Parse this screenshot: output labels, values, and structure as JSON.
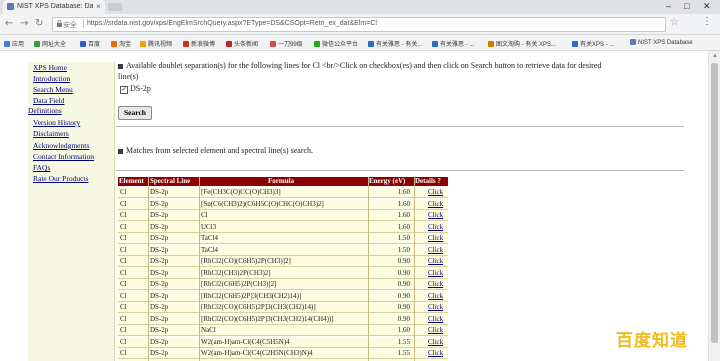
{
  "browser": {
    "tab_title": "NIST XPS Database: Da",
    "tab_close": "×",
    "win_min": "–",
    "win_max": "□",
    "win_close": "✕",
    "security_label": "安全",
    "url": "https://srdata.nist.gov/xps/EngElmSrchQuery.aspx?EType=DS&CSOpt=Retri_ex_dat&Elm=Cl",
    "back": "←",
    "forward": "→",
    "reload": "↻",
    "star": "☆",
    "menu": "⋮"
  },
  "bookmarks": [
    {
      "label": "应用",
      "color": "#4a7ad1"
    },
    {
      "label": "网址大全",
      "color": "#3b9c3b"
    },
    {
      "label": "百度",
      "color": "#2a5bd7"
    },
    {
      "label": "淘宝",
      "color": "#ff6600"
    },
    {
      "label": "腾讯视频",
      "color": "#ff9900"
    },
    {
      "label": "新浪微博",
      "color": "#d52b1e"
    },
    {
      "label": "头条新闻",
      "color": "#cc2222"
    },
    {
      "label": "一刀99级",
      "color": "#d44"
    },
    {
      "label": "微信公众平台",
      "color": "#1aad19"
    },
    {
      "label": "有关雅思 - 有关...",
      "color": "#2c6cc4"
    },
    {
      "label": "有关雅思 - ...",
      "color": "#2c6cc4"
    },
    {
      "label": "图文淘购 - 有关 XPS...",
      "color": "#d97b00"
    },
    {
      "label": "有关XPS - ...",
      "color": "#2c6cc4"
    },
    {
      "label": "NIST XPS Database",
      "color": "#5b7fb0"
    }
  ],
  "sidebar": {
    "items": [
      "XPS Home",
      "Introduction",
      "Search Menu",
      "Data Field",
      "Definitions",
      "Version History",
      "Disclaimers",
      "Acknowledgments",
      "Contact Information",
      "FAQs",
      "Rate Our Products"
    ]
  },
  "form": {
    "instruction": "Available doublet separation(s) for the following lines for Cl <br/>Click on checkbox(es) and then click on Search button to retrieve data for desired",
    "instruction_line2": "line(s)",
    "checkbox_label": "DS-2p",
    "checkbox_checked": "✓",
    "search_button": "Search"
  },
  "results": {
    "heading": "Matches from selected element and spectral line(s) search.",
    "columns": [
      "Element",
      "Spectral Line",
      "Formula",
      "Energy (eV)",
      "Details ?"
    ],
    "rows": [
      [
        "Cl",
        "DS-2p",
        "[Fe(CH3C(O)CC(O)CH3)3]",
        "1.60",
        "Click"
      ],
      [
        "Cl",
        "DS-2p",
        "[Sn(C6(CH3)2)(C6H5C(O)CHC(O)CH3)2]",
        "1.60",
        "Click"
      ],
      [
        "Cl",
        "DS-2p",
        "Cl",
        "1.60",
        "Click"
      ],
      [
        "Cl",
        "DS-2p",
        "UCl3",
        "1.60",
        "Click"
      ],
      [
        "Cl",
        "DS-2p",
        "TaCl4",
        "1.50",
        "Click"
      ],
      [
        "Cl",
        "DS-2p",
        "TaCl4",
        "1.50",
        "Click"
      ],
      [
        "Cl",
        "DS-2p",
        "[RhCl2(CO)(C6H5)2P(CH3)]2]",
        "0.90",
        "Click"
      ],
      [
        "Cl",
        "DS-2p",
        "[RhCl2(CH3)2P(CH3)2]",
        "0.90",
        "Click"
      ],
      [
        "Cl",
        "DS-2p",
        "[RhCl2(C6H5)2P(CH3)]2]",
        "0.90",
        "Click"
      ],
      [
        "Cl",
        "DS-2p",
        "[RhCl2(C6H5)2P]3(CH3(CH2)14)]",
        "0.90",
        "Click"
      ],
      [
        "Cl",
        "DS-2p",
        "[RhCl2(CO)(C6H5)2P]3(CH3(CH2)14)]",
        "0.90",
        "Click"
      ],
      [
        "Cl",
        "DS-2p",
        "[RhCl2(CO)(C6H5)2P]3(CH3(CH2)14(CH4))]",
        "0.90",
        "Click"
      ],
      [
        "Cl",
        "DS-2p",
        "NaCl",
        "1.60",
        "Click"
      ],
      [
        "Cl",
        "DS-2p",
        "W2(am-H)am-Cl(C4(C5H5N)4",
        "1.55",
        "Click"
      ],
      [
        "Cl",
        "DS-2p",
        "W2(am-H)am-Cl(C4(C2H5N(CH3)N)4",
        "1.55",
        "Click"
      ],
      [
        "Cl",
        "DS-2p",
        "Cl2.0SnAs0.96",
        "1.60",
        "Click"
      ]
    ]
  },
  "watermark": "百度知道"
}
